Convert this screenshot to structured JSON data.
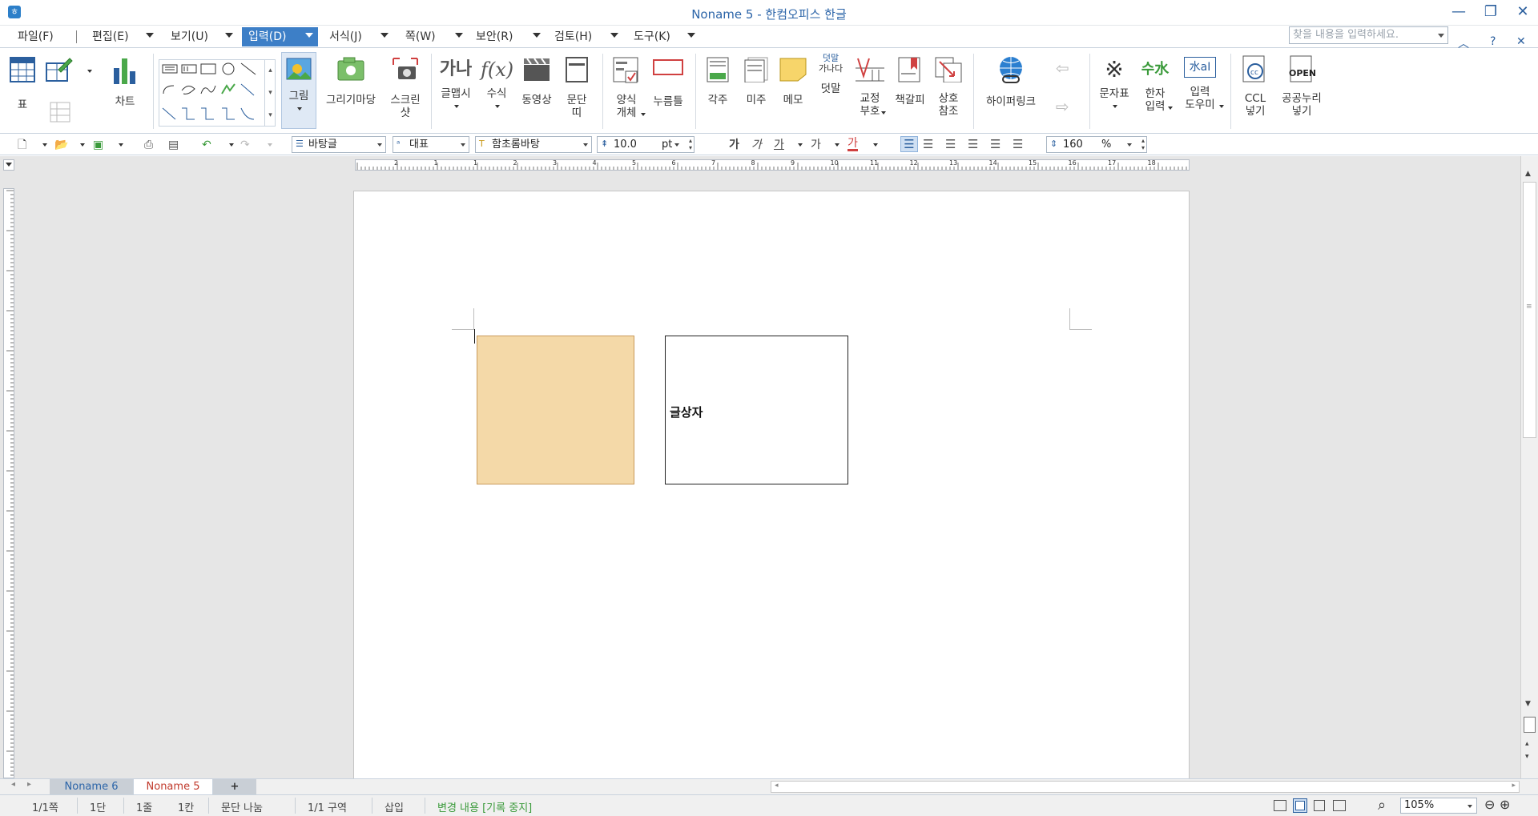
{
  "window": {
    "title": "Noname 5 - 한컴오피스 한글"
  },
  "menu": {
    "items": [
      {
        "label": "파일(F)"
      },
      {
        "label": "편집(E)"
      },
      {
        "label": "보기(U)"
      },
      {
        "label": "입력(D)"
      },
      {
        "label": "서식(J)"
      },
      {
        "label": "쪽(W)"
      },
      {
        "label": "보안(R)"
      },
      {
        "label": "검토(H)"
      },
      {
        "label": "도구(K)"
      }
    ],
    "search_placeholder": "찾을 내용을 입력하세요."
  },
  "ribbon": {
    "table": "표",
    "chart": "차트",
    "picture": "그림",
    "drawing_gallery": "그리기마당",
    "screenshot_1": "스크린",
    "screenshot_2": "샷",
    "word_art": "글맵시",
    "formula": "수식",
    "video": "동영상",
    "paragraph_1": "문단",
    "paragraph_2": "띠",
    "form_1": "양식",
    "form_2": "개체",
    "click_here": "누름틀",
    "footnote": "각주",
    "endnote": "미주",
    "memo": "메모",
    "overlay": "덧말",
    "overlay_icon_1": "덧말",
    "overlay_icon_2": "가나다",
    "proof_1": "교정",
    "proof_2": "부호",
    "bookmark": "책갈피",
    "cross_ref_1": "상호",
    "cross_ref_2": "참조",
    "hyperlink": "하이퍼링크",
    "char_map": "문자표",
    "hanja_1": "한자",
    "hanja_2": "입력",
    "input_helper_1": "입력",
    "input_helper_2": "도우미",
    "ccl_1": "CCL",
    "ccl_2": "넣기",
    "kogl_1": "공공누리",
    "kogl_2": "넣기"
  },
  "format": {
    "style": "바탕글",
    "lang": "대표",
    "font": "함초롬바탕",
    "size": "10.0",
    "size_unit": "pt",
    "bold": "가",
    "italic": "가",
    "underline": "가",
    "strike": "가",
    "color": "가",
    "line_spacing": "160",
    "line_spacing_unit": "%"
  },
  "ruler": {
    "h_labels": [
      "2",
      "1",
      "1",
      "2",
      "3",
      "4",
      "5",
      "6",
      "7",
      "8",
      "9",
      "10",
      "11",
      "12",
      "13",
      "14",
      "15",
      "16",
      "17",
      "18"
    ]
  },
  "document": {
    "textbox_text": "글상자"
  },
  "tabs": [
    {
      "label": "Noname 6",
      "active": false
    },
    {
      "label": "Noname 5",
      "active": true
    }
  ],
  "add_tab": "+",
  "status": {
    "page": "1/1쪽",
    "column": "1단",
    "line": "1줄",
    "col_pos": "1칸",
    "break": "문단 나눔",
    "section": "1/1 구역",
    "mode": "삽입",
    "track": "변경 내용 [기록 중지]",
    "zoom": "105%"
  },
  "colors": {
    "accent": "#3d7fc7",
    "title_text": "#2b64a8",
    "shape_fill": "#f4d9a8",
    "shape_border": "#c99a5b",
    "track_text": "#3a9a3a",
    "active_tab_text": "#c0392b"
  }
}
